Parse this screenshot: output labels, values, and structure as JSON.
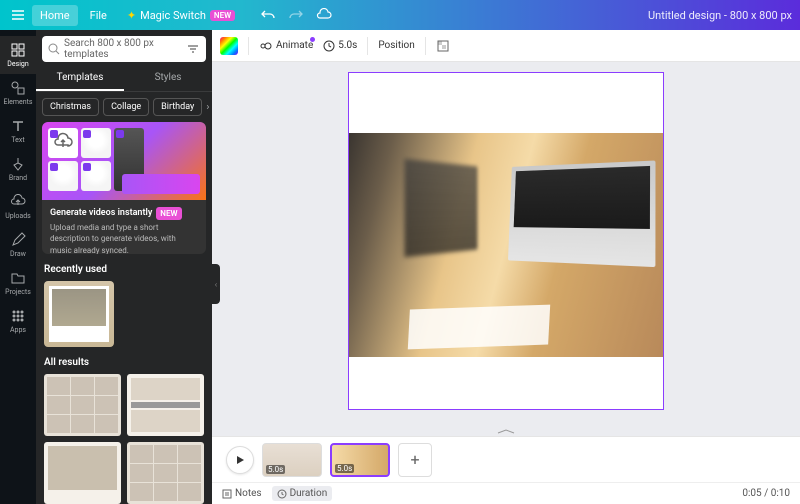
{
  "topbar": {
    "home": "Home",
    "file": "File",
    "magic_switch": "Magic Switch",
    "new_badge": "NEW",
    "doc_title": "Untitled design - 800 x 800 px"
  },
  "rail": {
    "design": "Design",
    "elements": "Elements",
    "text": "Text",
    "brand": "Brand",
    "uploads": "Uploads",
    "draw": "Draw",
    "projects": "Projects",
    "apps": "Apps"
  },
  "search": {
    "placeholder": "Search 800 x 800 px templates"
  },
  "tabs": {
    "templates": "Templates",
    "styles": "Styles"
  },
  "pills": {
    "christmas": "Christmas",
    "collage": "Collage",
    "birthday": "Birthday"
  },
  "promo": {
    "title": "Generate videos instantly",
    "badge": "NEW",
    "desc": "Upload media and type a short description to generate videos, with music already synced."
  },
  "sections": {
    "recent": "Recently used",
    "all": "All results"
  },
  "toolbar": {
    "animate": "Animate",
    "duration": "5.0s",
    "position": "Position"
  },
  "timeline": {
    "clip1": "5.0s",
    "clip2": "5.0s",
    "notes": "Notes",
    "duration_btn": "Duration",
    "time": "0:05 / 0:10"
  }
}
